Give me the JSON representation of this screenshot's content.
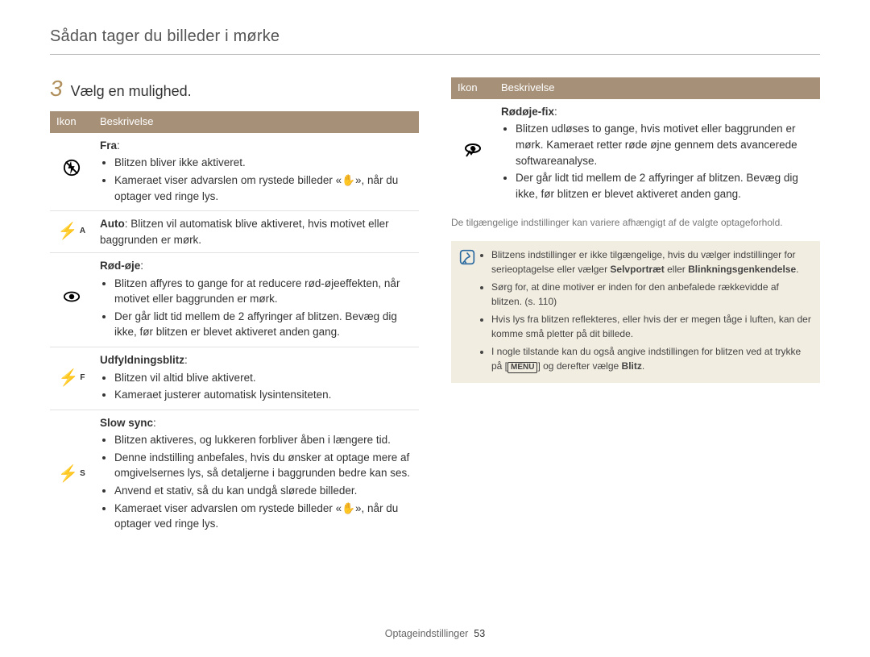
{
  "header": {
    "title": "Sådan tager du billeder i mørke"
  },
  "step": {
    "number": "3",
    "text": "Vælg en mulighed."
  },
  "table_headers": {
    "icon": "Ikon",
    "desc": "Beskrivelse"
  },
  "left_rows": [
    {
      "icon_name": "flash-off-icon",
      "title": "Fra",
      "bullets": [
        "Blitzen bliver ikke aktiveret.",
        "Kameraet viser advarslen om rystede billeder «✋», når du optager ved ringe lys."
      ]
    },
    {
      "icon_name": "flash-auto-icon",
      "title": "Auto",
      "inline_text": ": Blitzen vil automatisk blive aktiveret, hvis motivet eller baggrunden er mørk."
    },
    {
      "icon_name": "red-eye-icon",
      "title": "Rød-øje",
      "bullets": [
        "Blitzen affyres to gange for at reducere rød-øjeeffekten, når motivet eller baggrunden er mørk.",
        "Der går lidt tid mellem de 2 affyringer af blitzen. Bevæg dig ikke, før blitzen er blevet aktiveret anden gang."
      ]
    },
    {
      "icon_name": "flash-fill-icon",
      "title": "Udfyldningsblitz",
      "bullets": [
        "Blitzen vil altid blive aktiveret.",
        "Kameraet justerer automatisk lysintensiteten."
      ]
    },
    {
      "icon_name": "slow-sync-icon",
      "title": "Slow sync",
      "bullets": [
        "Blitzen aktiveres, og lukkeren forbliver åben i længere tid.",
        "Denne indstilling anbefales, hvis du ønsker at optage mere af omgivelsernes lys, så detaljerne i baggrunden bedre kan ses.",
        "Anvend et stativ, så du kan undgå slørede billeder.",
        "Kameraet viser advarslen om rystede billeder «✋», når du optager ved ringe lys."
      ]
    }
  ],
  "right_rows": [
    {
      "icon_name": "red-eye-fix-icon",
      "title": "Rødøje-fix",
      "bullets": [
        "Blitzen udløses to gange, hvis motivet eller baggrunden er mørk. Kameraet retter røde øjne gennem dets avancerede softwareanalyse.",
        "Der går lidt tid mellem de 2 affyringer af blitzen. Bevæg dig ikke, før blitzen er blevet aktiveret anden gang."
      ]
    }
  ],
  "right_note": "De tilgængelige indstillinger kan variere afhængigt af de valgte optageforhold.",
  "info": {
    "items": [
      {
        "pre": "Blitzens indstillinger er ikke tilgængelige, hvis du vælger indstillinger for serieoptagelse eller vælger ",
        "bold1": "Selvportræt",
        "mid": " eller ",
        "bold2": "Blinkningsgenkendelse",
        "post": "."
      },
      {
        "text": "Sørg for, at dine motiver er inden for den anbefalede rækkevidde af blitzen. (s. 110)"
      },
      {
        "text": "Hvis lys fra blitzen reflekteres, eller hvis der er megen tåge i luften, kan der komme små pletter på dit billede."
      },
      {
        "pre": "I nogle tilstande kan du også angive indstillingen for blitzen ved at trykke på [",
        "chip": "MENU",
        "mid2": "] og derefter vælge ",
        "bold3": "Blitz",
        "post2": "."
      }
    ]
  },
  "footer": {
    "section": "Optageindstillinger",
    "page": "53"
  }
}
